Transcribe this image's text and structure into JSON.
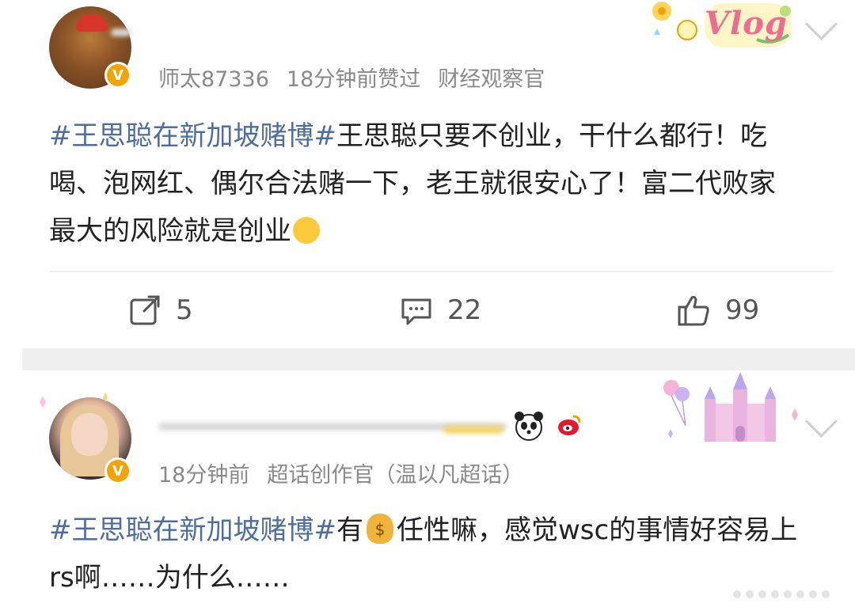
{
  "posts": [
    {
      "meta_user": "师太87336",
      "meta_time": "18分钟前赞过",
      "meta_role": "财经观察官",
      "topic": "#王思聪在新加坡赌博#",
      "text": "王思聪只要不创业，干什么都行！吃喝、泡网红、偶尔合法赌一下，老王就很安心了！富二代败家最大的风险就是创业",
      "actions": {
        "share": "5",
        "comment": "22",
        "like": "99"
      },
      "sticker_text": "Vlog"
    },
    {
      "meta_time": "18分钟前",
      "meta_role": "超话创作官（温以凡超话）",
      "topic": "#王思聪在新加坡赌博#",
      "text_before": "有",
      "text_after": "任性嘛，感觉wsc的事情好容易上rs啊……为什么……"
    }
  ],
  "icons": {
    "share": "share-icon",
    "comment": "comment-icon",
    "like": "thumbs-up-icon",
    "chevron": "chevron-down-icon",
    "verified": "verified-v-badge"
  },
  "colors": {
    "topic": "#4e6e9f",
    "badge": "#f5a300",
    "meta": "#8a8a8a",
    "divider": "#f0f0f0"
  }
}
